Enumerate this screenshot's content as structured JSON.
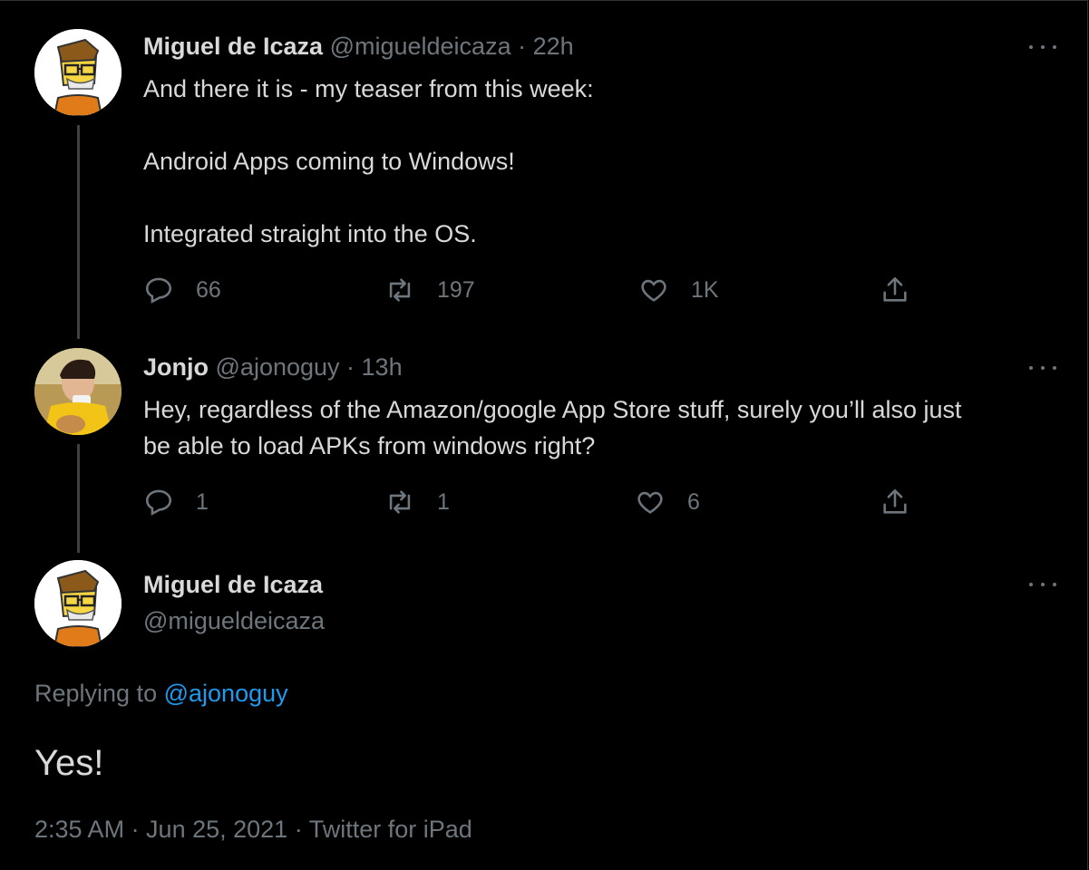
{
  "tweets": [
    {
      "name": "Miguel de Icaza",
      "handle": "@migueldeicaza",
      "time": "· 22h",
      "lines": [
        "And there it is - my teaser from this week:",
        "",
        "Android Apps coming to Windows!",
        "",
        "Integrated straight into the OS."
      ],
      "replies": "66",
      "retweets": "197",
      "likes": "1K"
    },
    {
      "name": "Jonjo",
      "handle": "@ajonoguy",
      "time": "· 13h",
      "lines": [
        "Hey, regardless of the Amazon/google App Store stuff, surely you’ll also just",
        "be able to load APKs from windows right?"
      ],
      "replies": "1",
      "retweets": "1",
      "likes": "6"
    }
  ],
  "main": {
    "name": "Miguel de Icaza",
    "handle": "@migueldeicaza",
    "replying_prefix": "Replying to",
    "replying_handle": "@ajonoguy",
    "text": "Yes!",
    "footer": "2:35 AM · Jun 25, 2021 · Twitter for iPad"
  },
  "colors": {
    "background": "#000000",
    "text": "#d9d9d9",
    "muted": "#6e767d",
    "link": "#1d9bf0"
  },
  "icons": [
    "reply-icon",
    "retweet-icon",
    "like-icon",
    "share-icon",
    "more-icon"
  ]
}
